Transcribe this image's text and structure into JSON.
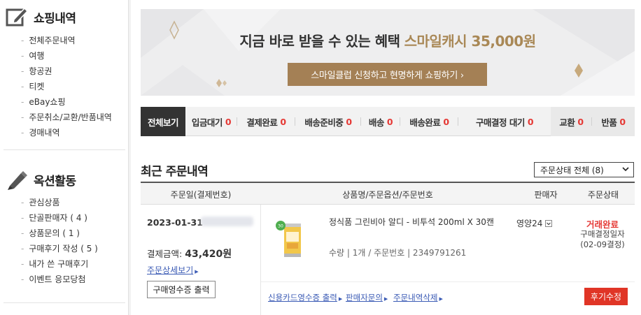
{
  "sidebar": {
    "shopping": {
      "title": "쇼핑내역",
      "icon": "edit-note-icon",
      "items": [
        "전체주문내역",
        "여행",
        "항공권",
        "티켓",
        "eBay쇼핑",
        "주문취소/교환/반품내역",
        "경매내역"
      ]
    },
    "auction": {
      "title": "옥션활동",
      "icon": "pencil-icon",
      "items": [
        "관심상품",
        "단골판매자 ( 4 )",
        "상품문의 ( 1 )",
        "구매후기 작성 ( 5 )",
        "내가 쓴 구매후기",
        "이벤트 응모당첨"
      ]
    }
  },
  "banner": {
    "headline": "지금 바로 받을 수 있는 혜택",
    "highlight": "스마일캐시 35,000원",
    "button_label": "스마일클럽 신청하고 현명하게 쇼핑하기 ›",
    "accent_color": "#a48055"
  },
  "tabs": [
    {
      "label": "전체보기",
      "count": ""
    },
    {
      "label": "입금대기",
      "count": "0"
    },
    {
      "label": "결제완료",
      "count": "0"
    },
    {
      "label": "배송준비중",
      "count": "0"
    },
    {
      "label": "배송",
      "count": "0"
    },
    {
      "label": "배송완료",
      "count": "0"
    },
    {
      "label": "구매결정 대기",
      "count": "0"
    },
    {
      "label": "교환",
      "count": "0"
    },
    {
      "label": "반품",
      "count": "0"
    }
  ],
  "recent": {
    "title": "최근 주문내역",
    "filter_selected": "주문상태 전체 (8)"
  },
  "table_head": {
    "col_date": "주문일(결제번호)",
    "col_product": "상품명/주문옵션/주문번호",
    "col_seller": "판매자",
    "col_status": "주문상태"
  },
  "order": {
    "date": "2023-01-31",
    "pay_label": "결제금액:",
    "pay_amount": "43,420원",
    "detail_link": "주문상세보기",
    "receipt_button": "구매영수증 출력",
    "product_name": "정식품 그린비아 알디 - 비투석 200ml X 30캔",
    "qty_text": "수량 | 1개 / 주문번호 | 2349791261",
    "seller": "영양24",
    "status": "거래완료",
    "status_sub1": "구매결정일자",
    "status_sub2": "(02-09결정)",
    "links": [
      "신용카드영수증 출력",
      "판매자문의",
      "주문내역삭제"
    ],
    "review_button": "후기수정",
    "status_color": "#e53935"
  }
}
